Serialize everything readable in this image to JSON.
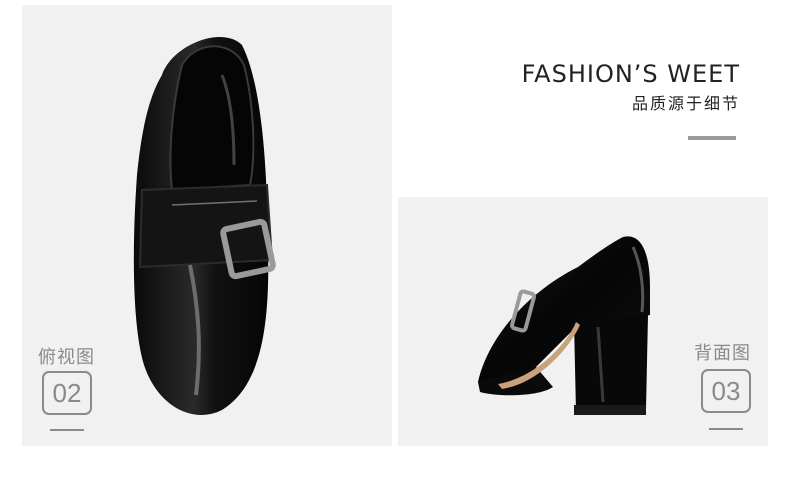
{
  "header": {
    "headline": "FASHION’S WEET",
    "subline": "品质源于细节"
  },
  "left_panel": {
    "caption": "俯视图",
    "number": "02",
    "image_subject": "black patent leather loafer with side buckle, top view"
  },
  "right_panel": {
    "caption": "背面图",
    "number": "03",
    "image_subject": "black patent leather loafer with block heel, back view"
  },
  "colors": {
    "panel_background": "#f1f1f1",
    "caption_gray": "#8a8a8a",
    "headline": "#222222"
  }
}
